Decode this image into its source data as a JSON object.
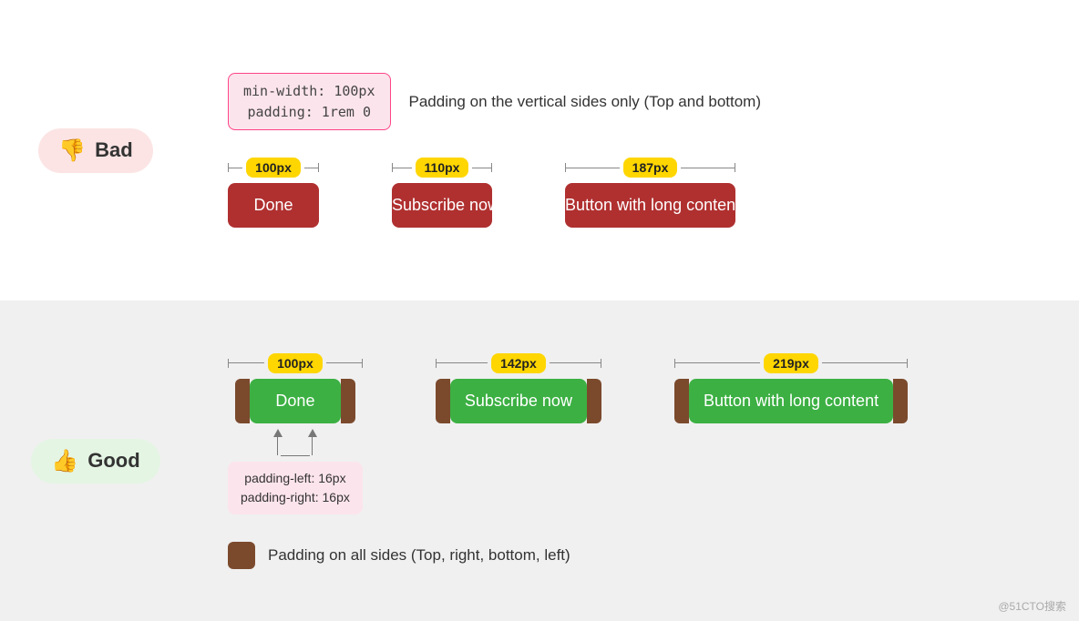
{
  "top_section": {
    "badge": {
      "icon": "👎",
      "label": "Bad"
    },
    "code_info": {
      "line1": "min-width: 100px",
      "line2": "padding: 1rem 0"
    },
    "description": "Padding on the vertical sides only (Top and bottom)",
    "buttons": [
      {
        "label": "Done",
        "width_label": "100px",
        "width_class": "btn-bad-done"
      },
      {
        "label": "Subscribe now",
        "width_label": "110px",
        "width_class": "btn-bad-subscribe"
      },
      {
        "label": "Button with long content",
        "width_label": "187px",
        "width_class": "btn-bad-long"
      }
    ]
  },
  "bottom_section": {
    "badge": {
      "icon": "👍",
      "label": "Good"
    },
    "buttons": [
      {
        "label": "Done",
        "width_label": "100px",
        "width_class": "btn-good-done"
      },
      {
        "label": "Subscribe now",
        "width_label": "142px",
        "width_class": "btn-good-subscribe"
      },
      {
        "label": "Button with long content",
        "width_label": "219px",
        "width_class": "btn-good-long"
      }
    ],
    "padding_note": {
      "line1": "padding-left: 16px",
      "line2": "padding-right: 16px"
    },
    "legend": {
      "text": "Padding on all sides (Top, right, bottom, left)"
    }
  },
  "watermark": "@51CTO搜索"
}
